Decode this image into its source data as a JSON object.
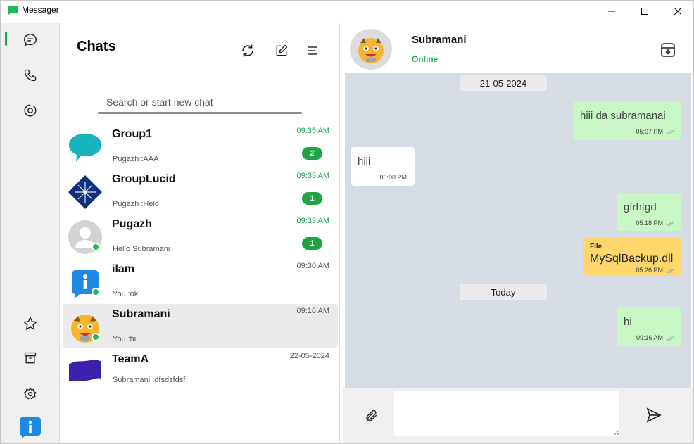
{
  "app": {
    "title": "Messager"
  },
  "chatlist": {
    "title": "Chats",
    "search_placeholder": "Search or start new chat",
    "items": [
      {
        "name": "Group1",
        "preview": "Pugazh :AAA",
        "time": "09:35 AM",
        "time_green": true,
        "unread": "2",
        "online": false,
        "avatar": "teal-bubble-avatar"
      },
      {
        "name": "GroupLucid",
        "preview": "Pugazh :Helo",
        "time": "09:33 AM",
        "time_green": true,
        "unread": "1",
        "online": false,
        "avatar": "blue-star-avatar"
      },
      {
        "name": "Pugazh",
        "preview": "Hello Subramani",
        "time": "09:33 AM",
        "time_green": true,
        "unread": "1",
        "online": true,
        "avatar": "default-person-avatar"
      },
      {
        "name": "ilam",
        "preview": "You :ok",
        "time": "09:30 AM",
        "time_green": false,
        "unread": "",
        "online": true,
        "avatar": "info-avatar"
      },
      {
        "name": "Subramani",
        "preview": "You :hi",
        "time": "09:16 AM",
        "time_green": false,
        "unread": "",
        "online": true,
        "avatar": "emoji-face-avatar"
      },
      {
        "name": "TeamA",
        "preview": "Subramani :dfsdsfdsf",
        "time": "22-05-2024",
        "time_green": false,
        "unread": "",
        "online": false,
        "avatar": "purple-wave-avatar"
      }
    ]
  },
  "conversation": {
    "name": "Subramani",
    "status": "Online",
    "dates": [
      "21-05-2024",
      "Today"
    ],
    "messages": [
      {
        "dir": "out",
        "text": "hiii da subramanai",
        "time": "05:07 PM"
      },
      {
        "dir": "in",
        "text": "hiii",
        "time": "05:08 PM"
      },
      {
        "dir": "out",
        "text": "gfrhtgd",
        "time": "05:18 PM"
      },
      {
        "dir": "file",
        "label": "File",
        "text": "MySqlBackup.dll",
        "time": "05:26 PM"
      },
      {
        "dir": "out",
        "text": "hi",
        "time": "09:16 AM"
      }
    ],
    "composer_placeholder": ""
  },
  "colors": {
    "accent": "#1aa84f",
    "outgoing": "#c8f7c5",
    "incoming": "#ffffff",
    "file": "#ffd66b",
    "chat_bg": "#d6dce3",
    "badge": "#20a545"
  },
  "icons": [
    "chat-icon",
    "phone-icon",
    "status-icon",
    "star-icon",
    "archive-icon",
    "gear-icon",
    "info-icon",
    "refresh-icon",
    "new-chat-icon",
    "filter-icon",
    "archive-download-icon",
    "paperclip-icon",
    "send-icon"
  ]
}
